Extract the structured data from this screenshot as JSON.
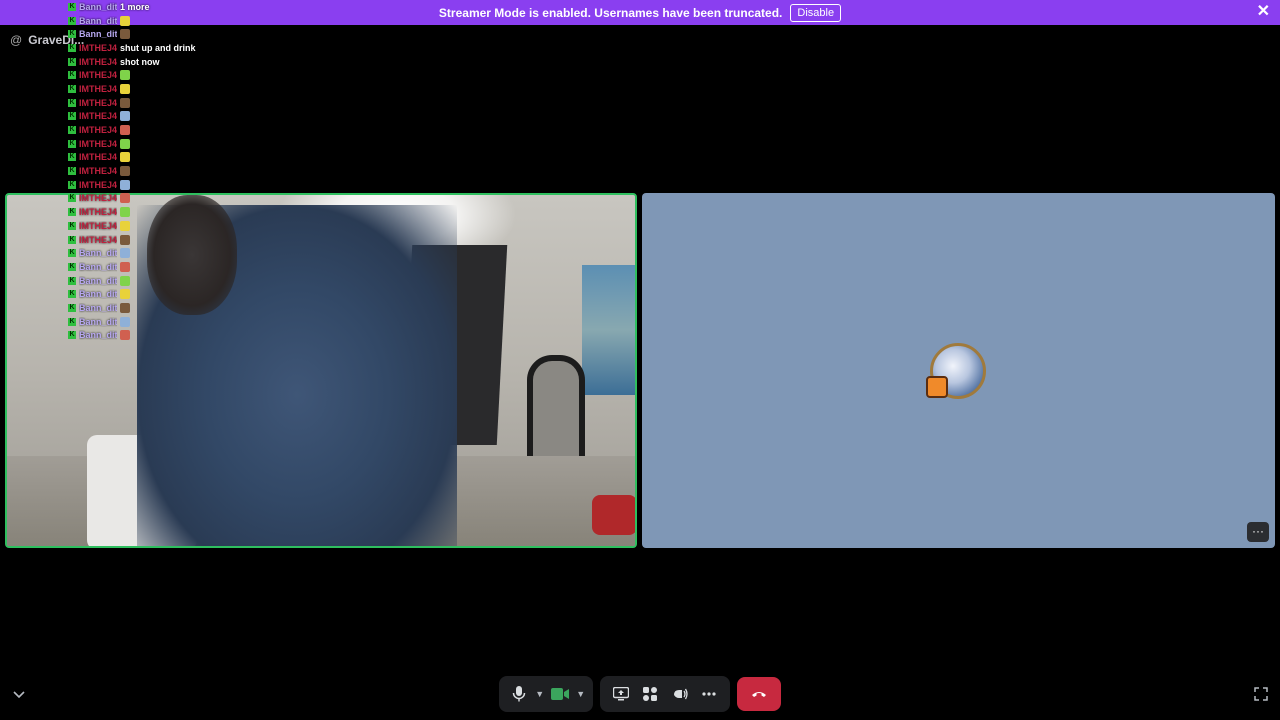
{
  "banner": {
    "message": "Streamer Mode is enabled. Usernames have been truncated.",
    "disable_label": "Disable",
    "close_icon": "close-icon",
    "color": "#8a3ff0"
  },
  "channel": {
    "at_symbol": "@",
    "name": "GraveDi..."
  },
  "chat": {
    "rows": [
      {
        "name": "Bann_dit",
        "name_color": "#b7a8f0",
        "text": "1 more"
      },
      {
        "name": "Bann_dit",
        "name_color": "#b7a8f0",
        "text": ""
      },
      {
        "name": "Bann_dit",
        "name_color": "#b7a8f0",
        "text": ""
      },
      {
        "name": "IMTHEJ4",
        "name_color": "#c0213f",
        "text": "shut up and drink"
      },
      {
        "name": "IMTHEJ4",
        "name_color": "#c0213f",
        "text": "shot now"
      },
      {
        "name": "IMTHEJ4",
        "name_color": "#c0213f",
        "text": ""
      },
      {
        "name": "IMTHEJ4",
        "name_color": "#c0213f",
        "text": ""
      },
      {
        "name": "IMTHEJ4",
        "name_color": "#c0213f",
        "text": ""
      },
      {
        "name": "IMTHEJ4",
        "name_color": "#c0213f",
        "text": ""
      },
      {
        "name": "IMTHEJ4",
        "name_color": "#c0213f",
        "text": ""
      },
      {
        "name": "IMTHEJ4",
        "name_color": "#c0213f",
        "text": ""
      },
      {
        "name": "IMTHEJ4",
        "name_color": "#c0213f",
        "text": ""
      },
      {
        "name": "IMTHEJ4",
        "name_color": "#c0213f",
        "text": ""
      },
      {
        "name": "IMTHEJ4",
        "name_color": "#c0213f",
        "text": ""
      },
      {
        "name": "IMTHEJ4",
        "name_color": "#c0213f",
        "text": ""
      },
      {
        "name": "IMTHEJ4",
        "name_color": "#c0213f",
        "text": ""
      },
      {
        "name": "IMTHEJ4",
        "name_color": "#c0213f",
        "text": ""
      },
      {
        "name": "IMTHEJ4",
        "name_color": "#c0213f",
        "text": ""
      },
      {
        "name": "Bann_dit",
        "name_color": "#b7a8f0",
        "text": ""
      },
      {
        "name": "Bann_dit",
        "name_color": "#b7a8f0",
        "text": ""
      },
      {
        "name": "Bann_dit",
        "name_color": "#b7a8f0",
        "text": ""
      },
      {
        "name": "Bann_dit",
        "name_color": "#b7a8f0",
        "text": ""
      },
      {
        "name": "Bann_dit",
        "name_color": "#b7a8f0",
        "text": ""
      },
      {
        "name": "Bann_dit",
        "name_color": "#b7a8f0",
        "text": ""
      },
      {
        "name": "Bann_dit",
        "name_color": "#b7a8f0",
        "text": ""
      }
    ],
    "emote_colors": [
      "#7fd34a",
      "#e8d23a",
      "#7a5a3c",
      "#8fb0d8",
      "#d06050"
    ]
  },
  "tiles": {
    "camera_border_color": "#2fbf5f",
    "placeholder_bg": "#7f97b6",
    "more_label": "···"
  },
  "toolbar": {
    "mic_icon": "microphone-icon",
    "camera_icon": "camera-icon",
    "screenshare_icon": "screen-share-icon",
    "activities_icon": "activities-icon",
    "soundboard_icon": "soundboard-icon",
    "more_icon": "more-icon",
    "leave_icon": "phone-hangup-icon",
    "leave_color": "#c7293f"
  }
}
